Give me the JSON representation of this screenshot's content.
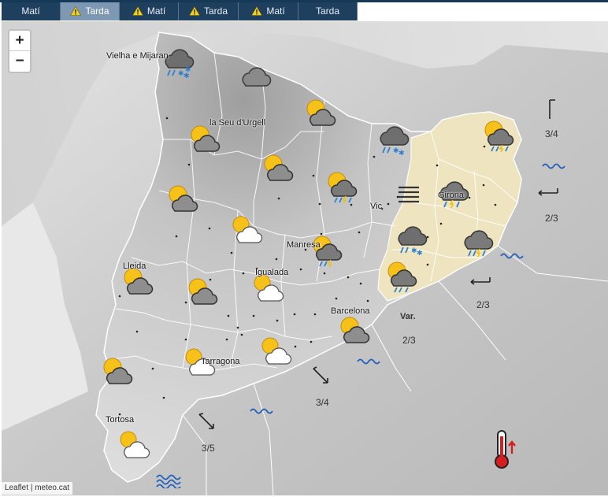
{
  "tabs": [
    {
      "label": "Matí",
      "warning": false
    },
    {
      "label": "Tarda",
      "warning": true,
      "active": true
    },
    {
      "label": "Matí",
      "warning": true
    },
    {
      "label": "Tarda",
      "warning": true
    },
    {
      "label": "Matí",
      "warning": true
    },
    {
      "label": "Tarda",
      "warning": false
    }
  ],
  "zoom": {
    "in_label": "+",
    "out_label": "−"
  },
  "attribution": {
    "leaflet": "Leaflet",
    "separator": "|",
    "source": "meteo.cat"
  },
  "cities": [
    {
      "name": "Vielha e Mijaran"
    },
    {
      "name": "la Seu d'Urgell"
    },
    {
      "name": "Girona"
    },
    {
      "name": "Vic"
    },
    {
      "name": "Manresa"
    },
    {
      "name": "Lleida"
    },
    {
      "name": "Igualada"
    },
    {
      "name": "Barcelona"
    },
    {
      "name": "Tarragona"
    },
    {
      "name": "Tortosa"
    }
  ],
  "weather_icons": [
    {
      "type": "snow-showers-icon"
    },
    {
      "type": "cloudy-icon"
    },
    {
      "type": "partly-cloudy-icon"
    },
    {
      "type": "partly-cloudy-icon"
    },
    {
      "type": "snow-showers-icon"
    },
    {
      "type": "storm-rain-icon"
    },
    {
      "type": "partly-cloudy-icon"
    },
    {
      "type": "storm-rain-icon"
    },
    {
      "type": "partly-cloudy-icon"
    },
    {
      "type": "fog-icon"
    },
    {
      "type": "storm-icon"
    },
    {
      "type": "snow-showers-icon"
    },
    {
      "type": "storm-rain-icon"
    },
    {
      "type": "sun-cloud-light-icon"
    },
    {
      "type": "storm-rain-icon"
    },
    {
      "type": "partly-cloudy-icon"
    },
    {
      "type": "partly-cloudy-icon"
    },
    {
      "type": "sun-cloud-light-icon"
    },
    {
      "type": "sun-cloud-light-icon"
    },
    {
      "type": "partly-cloudy-icon"
    },
    {
      "type": "sun-cloud-light-icon"
    },
    {
      "type": "partly-cloudy-icon"
    },
    {
      "type": "sun-cloud-light-icon"
    },
    {
      "type": "sun-cloud-light-icon"
    }
  ],
  "sea_states": [
    {
      "text": "3/4"
    },
    {
      "text": "2/3"
    },
    {
      "text": "2/3"
    },
    {
      "text": "Var."
    },
    {
      "text": "2/3"
    },
    {
      "text": "3/4"
    },
    {
      "text": "3/5"
    }
  ],
  "warning_zone_color": "#f0e6bf",
  "land_color": "#d9d9d9",
  "sea_color": "#c9c9c9",
  "thermometer": {
    "icon": "thermometer-rising-icon",
    "color": "#d61e1e"
  }
}
